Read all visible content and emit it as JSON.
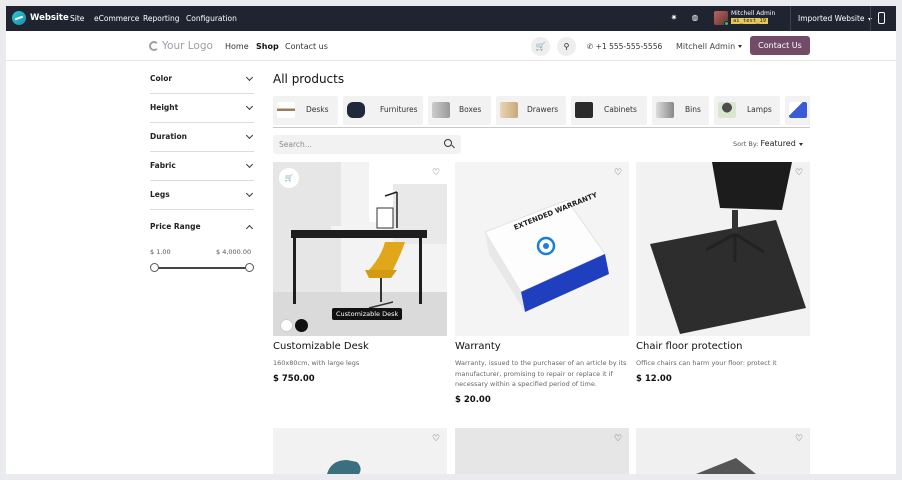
{
  "adminbar": {
    "brand": "Website",
    "menu": [
      "Site",
      "eCommerce",
      "Reporting",
      "Configuration"
    ],
    "user_name": "Mitchell Admin",
    "db_tag": "ai_test_19",
    "website_switch": "Imported Website"
  },
  "header": {
    "logo": "Your Logo",
    "nav": [
      "Home",
      "Shop",
      "Contact us"
    ],
    "phone": "+1 555-555-5556",
    "user": "Mitchell Admin",
    "contact_button": "Contact Us"
  },
  "filters": {
    "items": [
      "Color",
      "Height",
      "Duration",
      "Fabric",
      "Legs"
    ],
    "price_range": {
      "label": "Price Range",
      "min_label": "$ 1.00",
      "max_label": "$ 4,000.00"
    }
  },
  "main": {
    "title": "All products",
    "categories": [
      "Desks",
      "Furnitures",
      "Boxes",
      "Drawers",
      "Cabinets",
      "Bins",
      "Lamps"
    ],
    "search_placeholder": "Search...",
    "sort_label": "Sort By:",
    "sort_value": "Featured"
  },
  "products": [
    {
      "name": "Customizable Desk",
      "description": "160x80cm, with large legs",
      "price": "$ 750.00",
      "tooltip": "Customizable Desk"
    },
    {
      "name": "Warranty",
      "description": "Warranty, issued to the purchaser of an article by its manufacturer, promising to repair or replace it if necessary within a specified period of time.",
      "price": "$ 20.00",
      "box_text": "EXTENDED WARRANTY"
    },
    {
      "name": "Chair floor protection",
      "description": "Office chairs can harm your floor: protect it",
      "price": "$ 12.00"
    }
  ]
}
